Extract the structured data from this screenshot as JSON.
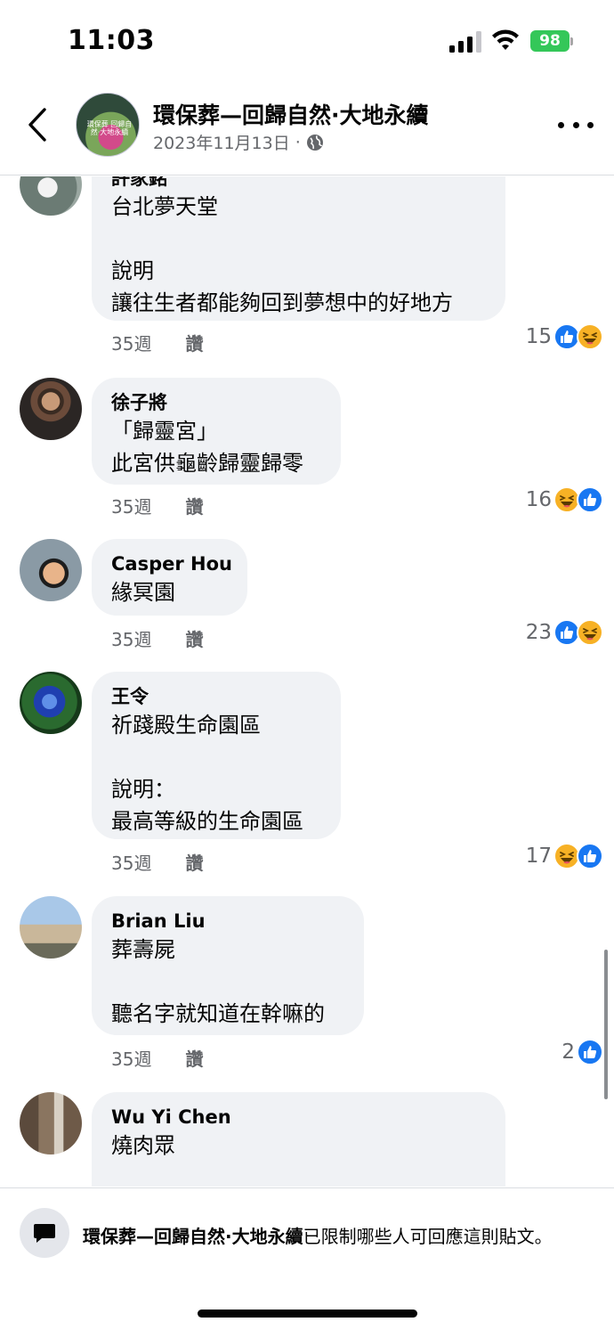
{
  "status_bar": {
    "time": "11:03",
    "battery": "98",
    "icons": [
      "signal-icon",
      "wifi-icon",
      "battery-icon"
    ]
  },
  "header": {
    "title": "環保葬—回歸自然·大地永續",
    "date": "2023年11月13日",
    "separator": "·",
    "avatar_text": "環保葬 回歸自然·大地永續",
    "icons": [
      "back-icon",
      "globe-icon",
      "more-icon"
    ]
  },
  "comments": [
    {
      "author": "許家銘",
      "text": "台北夢天堂\n\n說明\n讓往生者都能夠回到夢想中的好地方",
      "time": "35週",
      "like_label": "讚",
      "reaction_count": "15",
      "reactions": [
        "like",
        "haha"
      ]
    },
    {
      "author": "徐子將",
      "text": "「歸靈宮」\n此宮供龜齡歸靈歸零",
      "time": "35週",
      "like_label": "讚",
      "reaction_count": "16",
      "reactions": [
        "haha",
        "like"
      ]
    },
    {
      "author": "Casper Hou",
      "text": "緣冥園",
      "time": "35週",
      "like_label": "讚",
      "reaction_count": "23",
      "reactions": [
        "like",
        "haha"
      ]
    },
    {
      "author": "王令",
      "text": "祈踐殿生命園區\n\n說明：\n最高等級的生命園區",
      "time": "35週",
      "like_label": "讚",
      "reaction_count": "17",
      "reactions": [
        "haha",
        "like"
      ]
    },
    {
      "author": "Brian Liu",
      "text": "葬壽屍\n\n聽名字就知道在幹嘛的",
      "time": "35週",
      "like_label": "讚",
      "reaction_count": "2",
      "reactions": [
        "like"
      ]
    },
    {
      "author": "Wu Yi Chen",
      "text": "燒肉眾",
      "time": "",
      "like_label": "",
      "reaction_count": "",
      "reactions": []
    }
  ],
  "notice": {
    "page_name": "環保葬—回歸自然·大地永續",
    "message": "已限制哪些人可回應這則貼文。",
    "icon": "comment-bubble-icon"
  },
  "colors": {
    "like_blue": "#1877f2",
    "haha_yellow": "#f7b125",
    "bubble_bg": "#f0f2f5",
    "meta_gray": "#65676b",
    "battery_green": "#34c759"
  }
}
